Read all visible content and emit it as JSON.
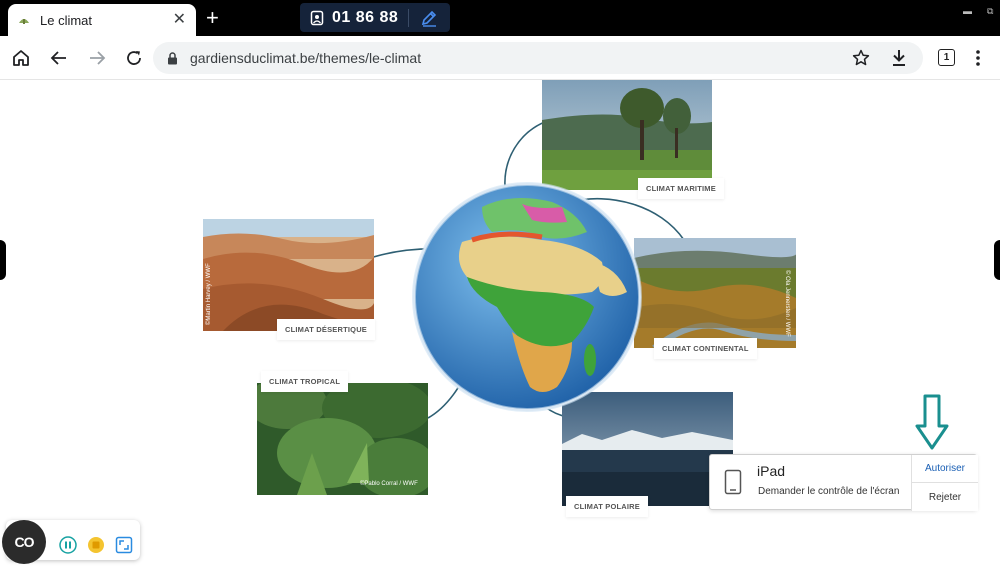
{
  "browser": {
    "tab_title": "Le climat",
    "new_tab_icon": "+",
    "url": "gardiensduclimat.be/themes/le-climat",
    "tab_count": "1"
  },
  "session": {
    "code": "01 86 88"
  },
  "page": {
    "climates": [
      {
        "label": "CLIMAT MARITIME"
      },
      {
        "label": "CLIMAT DÉSERTIQUE"
      },
      {
        "label": "CLIMAT CONTINENTAL"
      },
      {
        "label": "CLIMAT TROPICAL"
      },
      {
        "label": "CLIMAT POLAIRE"
      }
    ],
    "credits": {
      "desert": "©Martin Harvey / WWF",
      "continental": "© Ola Jennersten / WWF",
      "tropical": "©Pablo Corral / WWF"
    }
  },
  "remote_request": {
    "device": "iPad",
    "message": "Demander le contrôle de l'écran",
    "allow_label": "Autoriser",
    "reject_label": "Rejeter"
  },
  "colors": {
    "accent": "#1a5fb4",
    "annotation_arrow": "#1a8f8f",
    "ocean": "#2a76c6",
    "connector": "#2e5f73"
  }
}
